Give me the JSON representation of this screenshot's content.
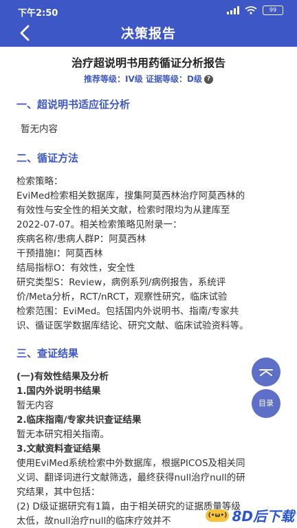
{
  "status": {
    "time": "下午2:50",
    "battery": "99"
  },
  "nav": {
    "title": "决策报告"
  },
  "report": {
    "title": "治疗超说明书用药循证分析报告",
    "grade_label": "推荐等级：IV级  证据等级：D级"
  },
  "sections": {
    "s1": {
      "title": "一、超说明书适应征分析",
      "body": "暂无内容"
    },
    "s2": {
      "title": "二、循证方法",
      "lines": [
        "检索策略：",
        "EviMed检索相关数据库，搜集阿莫西林治疗阿莫西林的",
        "有效性与安全性的相关文献，检索时限均为从建库至",
        "2022-07-07。相关检索策略见附录一：",
        "疾病名称/患病人群P：阿莫西林",
        "干预措施I：阿莫西林",
        "结局指标O：有效性，安全性",
        "研究类型S：Review，病例系列/病例报告，系统评",
        "价/Meta分析，RCT/nRCT，观察性研究，临床试验",
        "检索范围：EviMed。包括国内外说明书、指南/专家共",
        "识、循证医学数据库结论、研究文献、临床试验资料等。"
      ]
    },
    "s3": {
      "title": "三、查证结果",
      "lines": [
        "(一)有效性结果及分析",
        "1.国内外说明书结果",
        "暂无内容",
        "2.临床指南/专家共识查证结果",
        "暂无本研究相关指南。",
        "3.文献资料查证结果",
        "使用EviMed系统检索中外数据库，根据PICOS及相关同",
        "义词、翻译词进行文献筛选，最终获得null治疗null的研",
        "究结果，其中包括：",
        "(2) D级证据研究有1篇，由于相关研究的证据质量等级",
        "太低，故null治疗null的临床疗效并不"
      ]
    }
  },
  "float": {
    "toc_label": "目录"
  },
  "watermark": {
    "badge": "(•ω•)",
    "text": "8D后下载"
  }
}
